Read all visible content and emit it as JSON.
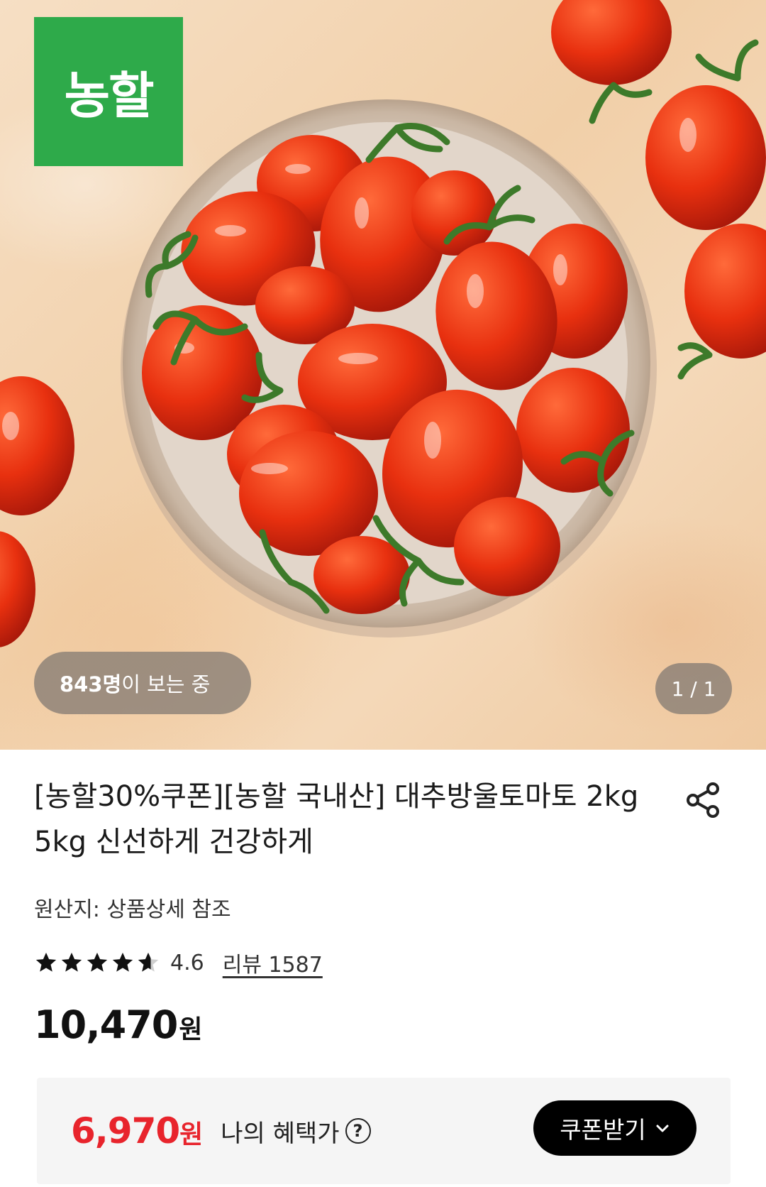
{
  "brand": {
    "logo_text": "농할",
    "logo_color": "#2eaa4a"
  },
  "gallery": {
    "viewers_count": "843명",
    "viewers_suffix": "이 보는 중",
    "pager": "1 / 1"
  },
  "product": {
    "title": "[농할30%쿠폰][농할 국내산] 대추방울토마토 2kg 5kg 신선하게 건강하게",
    "origin": "원산지: 상품상세 참조",
    "rating": 4.6,
    "rating_text": "4.6",
    "review_link": "리뷰 1587",
    "price_value": "10,470",
    "price_unit": "원"
  },
  "benefit": {
    "price_value": "6,970",
    "price_unit": "원",
    "label": "나의 혜택가",
    "help_icon": "?",
    "coupon_button": "쿠폰받기",
    "accent_color": "#e8242c"
  },
  "icons": [
    "share-icon",
    "star-icon",
    "half-star-icon",
    "chevron-down-icon",
    "help-icon"
  ]
}
